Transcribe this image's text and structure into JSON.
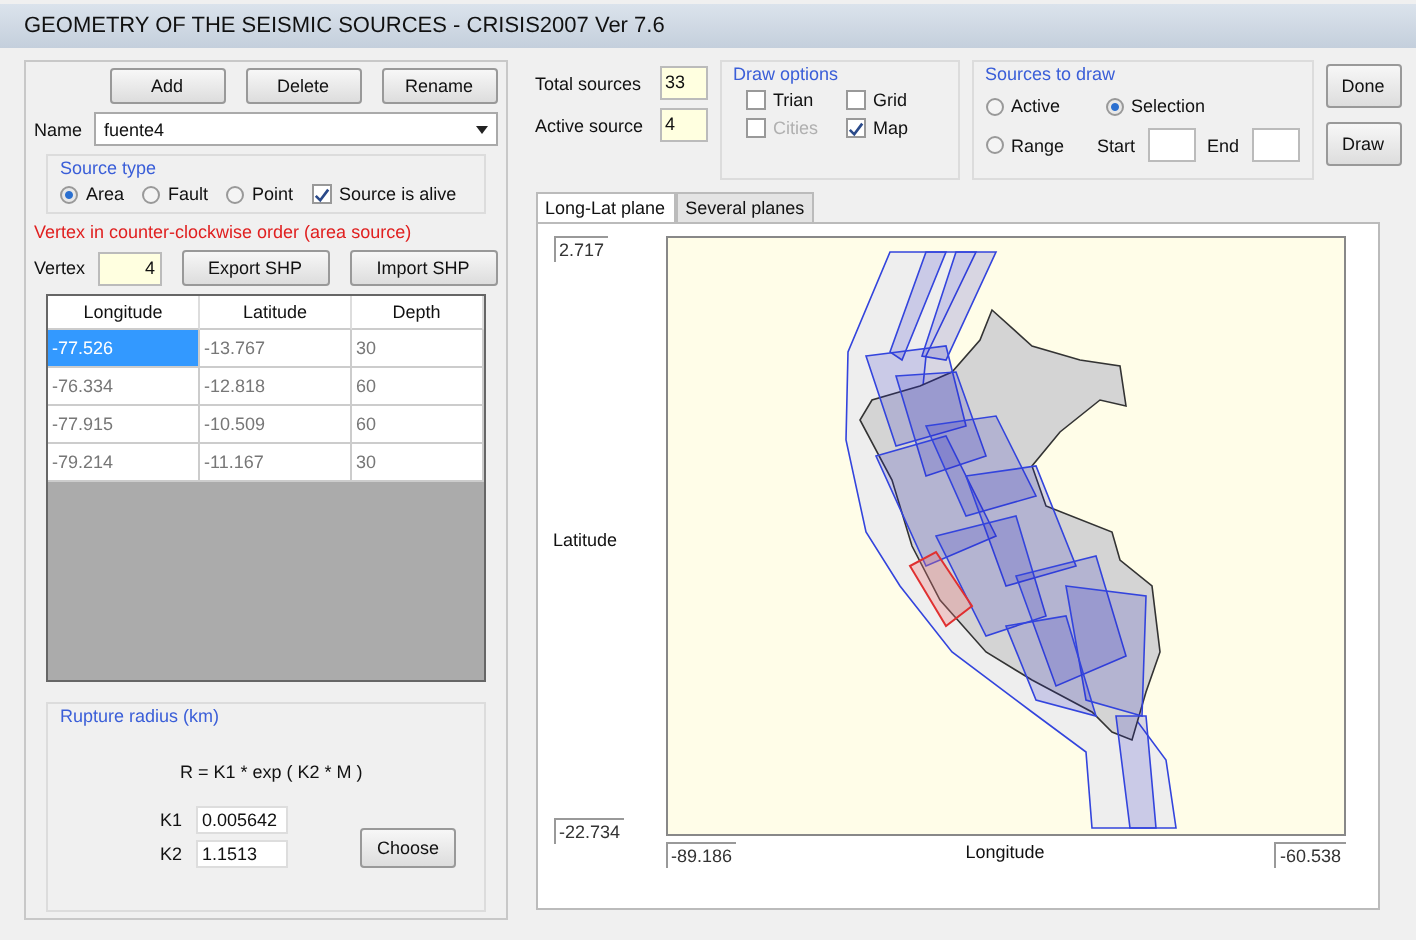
{
  "window": {
    "title": "GEOMETRY OF THE SEISMIC SOURCES - CRISIS2007 Ver 7.6"
  },
  "source_buttons": [
    "Add",
    "Delete",
    "Rename"
  ],
  "name": {
    "label": "Name",
    "value": "fuente4"
  },
  "source_type": {
    "title": "Source type",
    "options": [
      {
        "label": "Area",
        "selected": true
      },
      {
        "label": "Fault",
        "selected": false
      },
      {
        "label": "Point",
        "selected": false
      }
    ],
    "alive": {
      "label": "Source is alive",
      "checked": true
    }
  },
  "vertex_note": "Vertex in counter-clockwise order (area source)",
  "vertex": {
    "label": "Vertex",
    "value": "4"
  },
  "shp_buttons": [
    "Export SHP",
    "Import SHP"
  ],
  "table": {
    "columns": [
      "Longitude",
      "Latitude",
      "Depth"
    ],
    "rows": [
      {
        "cells": [
          "-77.526",
          "-13.767",
          "30"
        ],
        "selected": true
      },
      {
        "cells": [
          "-76.334",
          "-12.818",
          "60"
        ],
        "selected": false
      },
      {
        "cells": [
          "-77.915",
          "-10.509",
          "60"
        ],
        "selected": false
      },
      {
        "cells": [
          "-79.214",
          "-11.167",
          "30"
        ],
        "selected": false
      }
    ]
  },
  "rupture": {
    "title": "Rupture radius (km)",
    "formula": "R = K1 * exp ( K2 * M )",
    "k1": {
      "label": "K1",
      "value": "0.005642"
    },
    "k2": {
      "label": "K2",
      "value": "1.1513"
    },
    "button": "Choose"
  },
  "totals": [
    {
      "label": "Total sources",
      "value": "33"
    },
    {
      "label": "Active source",
      "value": "4"
    }
  ],
  "draw_options": {
    "title": "Draw options",
    "items": [
      {
        "label": "Trian",
        "checked": false,
        "disabled": false
      },
      {
        "label": "Grid",
        "checked": false,
        "disabled": false
      },
      {
        "label": "Cities",
        "checked": false,
        "disabled": true
      },
      {
        "label": "Map",
        "checked": true,
        "disabled": false
      }
    ]
  },
  "sources_to_draw": {
    "title": "Sources to draw",
    "options": [
      {
        "label": "Active",
        "selected": false
      },
      {
        "label": "Selection",
        "selected": true
      },
      {
        "label": "Range",
        "selected": false
      }
    ],
    "start_label": "Start",
    "end_label": "End"
  },
  "actions": [
    "Done",
    "Draw"
  ],
  "tabs": [
    {
      "label": "Long-Lat plane",
      "selected": true
    },
    {
      "label": "Several planes",
      "selected": false
    }
  ],
  "plot": {
    "y_max": "2.717",
    "y_min": "-22.734",
    "ylabel": "Latitude",
    "x_min": "-89.186",
    "x_max": "-60.538",
    "xlabel": "Longitude"
  }
}
